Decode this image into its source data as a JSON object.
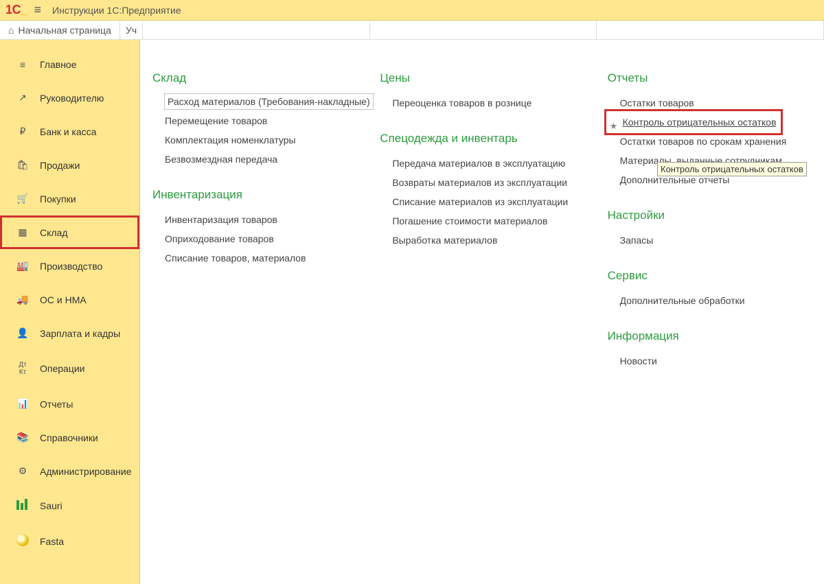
{
  "header": {
    "logo_text": "1C",
    "app_title": "Инструкции 1С:Предприятие"
  },
  "tabs": {
    "home_label": "Начальная страница",
    "partial_tab": "Уч"
  },
  "sidebar": {
    "items": [
      {
        "icon": "menu",
        "label": "Главное"
      },
      {
        "icon": "chart-up",
        "label": "Руководителю"
      },
      {
        "icon": "ruble",
        "label": "Банк и касса"
      },
      {
        "icon": "bag",
        "label": "Продажи"
      },
      {
        "icon": "cart",
        "label": "Покупки"
      },
      {
        "icon": "grid",
        "label": "Склад"
      },
      {
        "icon": "factory",
        "label": "Производство"
      },
      {
        "icon": "truck",
        "label": "ОС и НМА"
      },
      {
        "icon": "person",
        "label": "Зарплата и кадры"
      },
      {
        "icon": "ops",
        "label": "Операции"
      },
      {
        "icon": "bar-chart",
        "label": "Отчеты"
      },
      {
        "icon": "book",
        "label": "Справочники"
      },
      {
        "icon": "gear",
        "label": "Администрирование"
      },
      {
        "icon": "sauri",
        "label": "Sauri"
      },
      {
        "icon": "fasta",
        "label": "Fasta"
      }
    ]
  },
  "content": {
    "col1": {
      "sec1": {
        "title": "Склад",
        "items": [
          "Расход материалов (Требования-накладные)",
          "Перемещение товаров",
          "Комплектация номенклатуры",
          "Безвозмездная передача"
        ]
      },
      "sec2": {
        "title": "Инвентаризация",
        "items": [
          "Инвентаризация товаров",
          "Оприходование товаров",
          "Списание товаров, материалов"
        ]
      }
    },
    "col2": {
      "sec1": {
        "title": "Цены",
        "items": [
          "Переоценка товаров в рознице"
        ]
      },
      "sec2": {
        "title": "Спецодежда и инвентарь",
        "items": [
          "Передача материалов в эксплуатацию",
          "Возвраты материалов из эксплуатации",
          "Списание материалов из эксплуатации",
          "Погашение стоимости материалов",
          "Выработка материалов"
        ]
      }
    },
    "col3": {
      "sec1": {
        "title": "Отчеты",
        "items": [
          "Остатки товаров",
          "Контроль отрицательных остатков",
          "Остатки товаров по срокам хранения",
          "Материалы, выданные сотрудникам",
          "Дополнительные отчеты"
        ]
      },
      "sec2": {
        "title": "Настройки",
        "items": [
          "Запасы"
        ]
      },
      "sec3": {
        "title": "Сервис",
        "items": [
          "Дополнительные обработки"
        ]
      },
      "sec4": {
        "title": "Информация",
        "items": [
          "Новости"
        ]
      }
    }
  },
  "tooltip_text": "Контроль отрицательных остатков"
}
